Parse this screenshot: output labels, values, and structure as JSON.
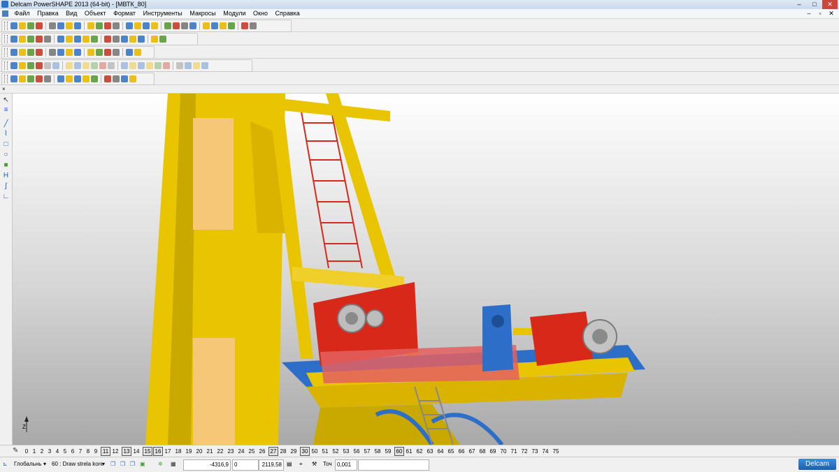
{
  "window": {
    "title": "Delcam PowerSHAPE 2013 (64-bit) - [МВТК_80]",
    "minimize": "–",
    "maximize": "□",
    "close": "✕"
  },
  "menu": {
    "items": [
      "Файл",
      "Правка",
      "Вид",
      "Объект",
      "Формат",
      "Инструменты",
      "Макросы",
      "Модули",
      "Окно",
      "Справка"
    ],
    "doc_minimize": "–",
    "doc_restore": "▫",
    "doc_close": "✕"
  },
  "toolbars": {
    "row1_colors": [
      "#3b78c4",
      "#e8b900",
      "#5a9a3a",
      "#c83a2a",
      "#7a7a7a",
      "#3b78c4",
      "#e8b900"
    ],
    "accent": "#e8b900"
  },
  "left_toolbar": {
    "icons": [
      "select-arrow-icon",
      "line-icon",
      "polyline-icon",
      "rectangle-icon",
      "circle-icon",
      "solid-icon",
      "dimension-icon",
      "curve-icon",
      "angle-icon"
    ]
  },
  "levels": {
    "items": [
      {
        "n": "0",
        "boxed": false
      },
      {
        "n": "1",
        "boxed": false
      },
      {
        "n": "2",
        "boxed": false
      },
      {
        "n": "3",
        "boxed": false
      },
      {
        "n": "4",
        "boxed": false
      },
      {
        "n": "5",
        "boxed": false
      },
      {
        "n": "6",
        "boxed": false
      },
      {
        "n": "7",
        "boxed": false
      },
      {
        "n": "8",
        "boxed": false
      },
      {
        "n": "9",
        "boxed": false
      },
      {
        "n": "11",
        "boxed": true
      },
      {
        "n": "12",
        "boxed": false
      },
      {
        "n": "13",
        "boxed": true
      },
      {
        "n": "14",
        "boxed": false
      },
      {
        "n": "15",
        "boxed": true
      },
      {
        "n": "16",
        "boxed": true
      },
      {
        "n": "17",
        "boxed": false
      },
      {
        "n": "18",
        "boxed": false
      },
      {
        "n": "19",
        "boxed": false
      },
      {
        "n": "20",
        "boxed": false
      },
      {
        "n": "21",
        "boxed": false
      },
      {
        "n": "22",
        "boxed": false
      },
      {
        "n": "23",
        "boxed": false
      },
      {
        "n": "24",
        "boxed": false
      },
      {
        "n": "25",
        "boxed": false
      },
      {
        "n": "26",
        "boxed": false
      },
      {
        "n": "27",
        "boxed": true
      },
      {
        "n": "28",
        "boxed": false
      },
      {
        "n": "29",
        "boxed": false
      },
      {
        "n": "30",
        "boxed": true
      },
      {
        "n": "50",
        "boxed": false
      },
      {
        "n": "51",
        "boxed": false
      },
      {
        "n": "52",
        "boxed": false
      },
      {
        "n": "53",
        "boxed": false
      },
      {
        "n": "56",
        "boxed": false
      },
      {
        "n": "57",
        "boxed": false
      },
      {
        "n": "58",
        "boxed": false
      },
      {
        "n": "59",
        "boxed": false
      },
      {
        "n": "60",
        "boxed": true
      },
      {
        "n": "61",
        "boxed": false
      },
      {
        "n": "62",
        "boxed": false
      },
      {
        "n": "63",
        "boxed": false
      },
      {
        "n": "64",
        "boxed": false
      },
      {
        "n": "65",
        "boxed": false
      },
      {
        "n": "66",
        "boxed": false
      },
      {
        "n": "67",
        "boxed": false
      },
      {
        "n": "68",
        "boxed": false
      },
      {
        "n": "69",
        "boxed": false
      },
      {
        "n": "70",
        "boxed": false
      },
      {
        "n": "71",
        "boxed": false
      },
      {
        "n": "72",
        "boxed": false
      },
      {
        "n": "73",
        "boxed": false
      },
      {
        "n": "74",
        "boxed": false
      },
      {
        "n": "75",
        "boxed": false
      }
    ]
  },
  "status": {
    "workplane": "Глобальнь",
    "level_select": "60 : Draw strela kore",
    "coord_x": "-4316,9",
    "coord_y": "0",
    "coord_z": "2119,58",
    "tolerance_label": "Точ",
    "tolerance_value": "0,001",
    "brand": "Delcam"
  },
  "viewport": {
    "axis_label": "Z",
    "colors": {
      "yellow": "#e9c400",
      "red": "#d8281a",
      "blue": "#2d6fc8",
      "pale": "#f6c777"
    }
  }
}
